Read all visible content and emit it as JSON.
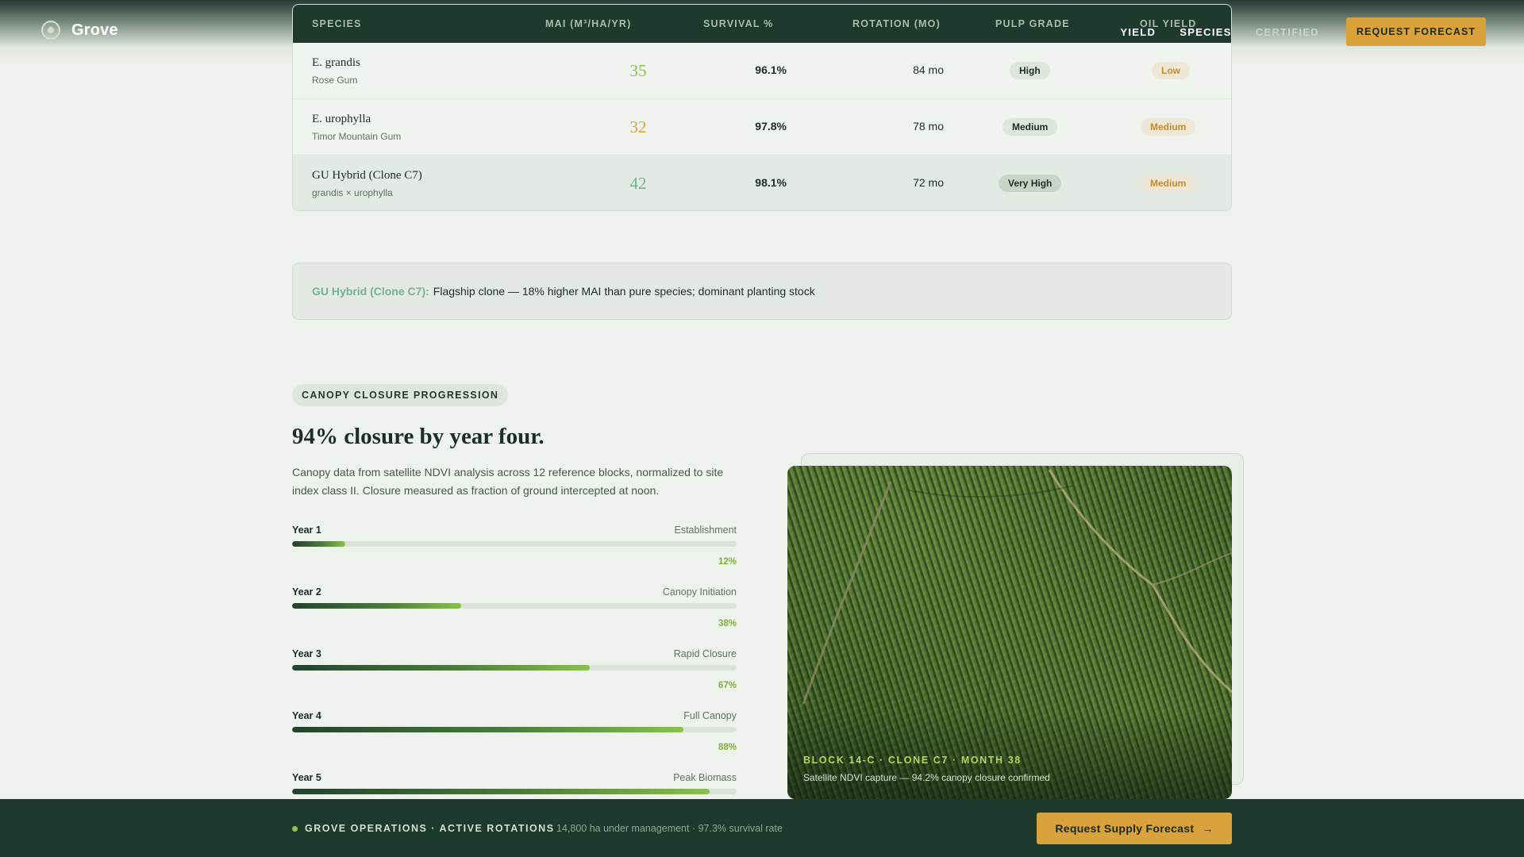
{
  "brand": {
    "name": "Grove"
  },
  "nav": {
    "items": [
      "YIELD",
      "SPECIES",
      "CERTIFIED"
    ]
  },
  "header": {
    "cta": "REQUEST FORECAST"
  },
  "table": {
    "columns": [
      "SPECIES",
      "MAI (M³/HA/YR)",
      "SURVIVAL %",
      "ROTATION (MO)",
      "PULP GRADE",
      "OIL YIELD"
    ],
    "rows": [
      {
        "name": "E. grandis",
        "common": "Rose Gum",
        "mai": "35",
        "mai_color": "#8cbf4e",
        "survival": "96.1%",
        "rotation": "84 mo",
        "pulp": "High",
        "oil": "Low"
      },
      {
        "name": "E. urophylla",
        "common": "Timor Mountain Gum",
        "mai": "32",
        "mai_color": "#d9a23a",
        "survival": "97.8%",
        "rotation": "78 mo",
        "pulp": "Medium",
        "oil": "Medium"
      },
      {
        "name": "GU Hybrid (Clone C7)",
        "common": "grandis × urophylla",
        "mai": "42",
        "mai_color": "#6fb48f",
        "survival": "98.1%",
        "rotation": "72 mo",
        "pulp": "Very High",
        "oil": "Medium"
      }
    ]
  },
  "callout": {
    "lead": "GU Hybrid (Clone C7):",
    "body": "Flagship clone — 18% higher MAI than pure species; dominant planting stock"
  },
  "canopy": {
    "tag": "CANOPY CLOSURE PROGRESSION",
    "headline": "94% closure by year four.",
    "description": "Canopy data from satellite NDVI analysis across 12 reference blocks, normalized to site index class II. Closure measured as fraction of ground intercepted at noon.",
    "progress": [
      {
        "year": "Year 1",
        "stage": "Establishment",
        "pct": "12%",
        "value": 12
      },
      {
        "year": "Year 2",
        "stage": "Canopy Initiation",
        "pct": "38%",
        "value": 38
      },
      {
        "year": "Year 3",
        "stage": "Rapid Closure",
        "pct": "67%",
        "value": 67
      },
      {
        "year": "Year 4",
        "stage": "Full Canopy",
        "pct": "88%",
        "value": 88
      },
      {
        "year": "Year 5",
        "stage": "Peak Biomass",
        "pct": "",
        "value": 94
      }
    ]
  },
  "photo": {
    "caption_title": "BLOCK 14-C · CLONE C7 · MONTH 38",
    "caption_sub": "Satellite NDVI capture — 94.2% canopy closure confirmed"
  },
  "bottombar": {
    "title": "GROVE OPERATIONS · ACTIVE ROTATIONS",
    "meta": "14,800 ha under management · 97.3% survival rate",
    "cta": "Request Supply Forecast",
    "cta_icon": "→"
  },
  "colors": {
    "accent": "#d9a23a",
    "dark_green": "#1e3a2c",
    "light_green": "#8cbf4e",
    "teal": "#6fb48f"
  }
}
